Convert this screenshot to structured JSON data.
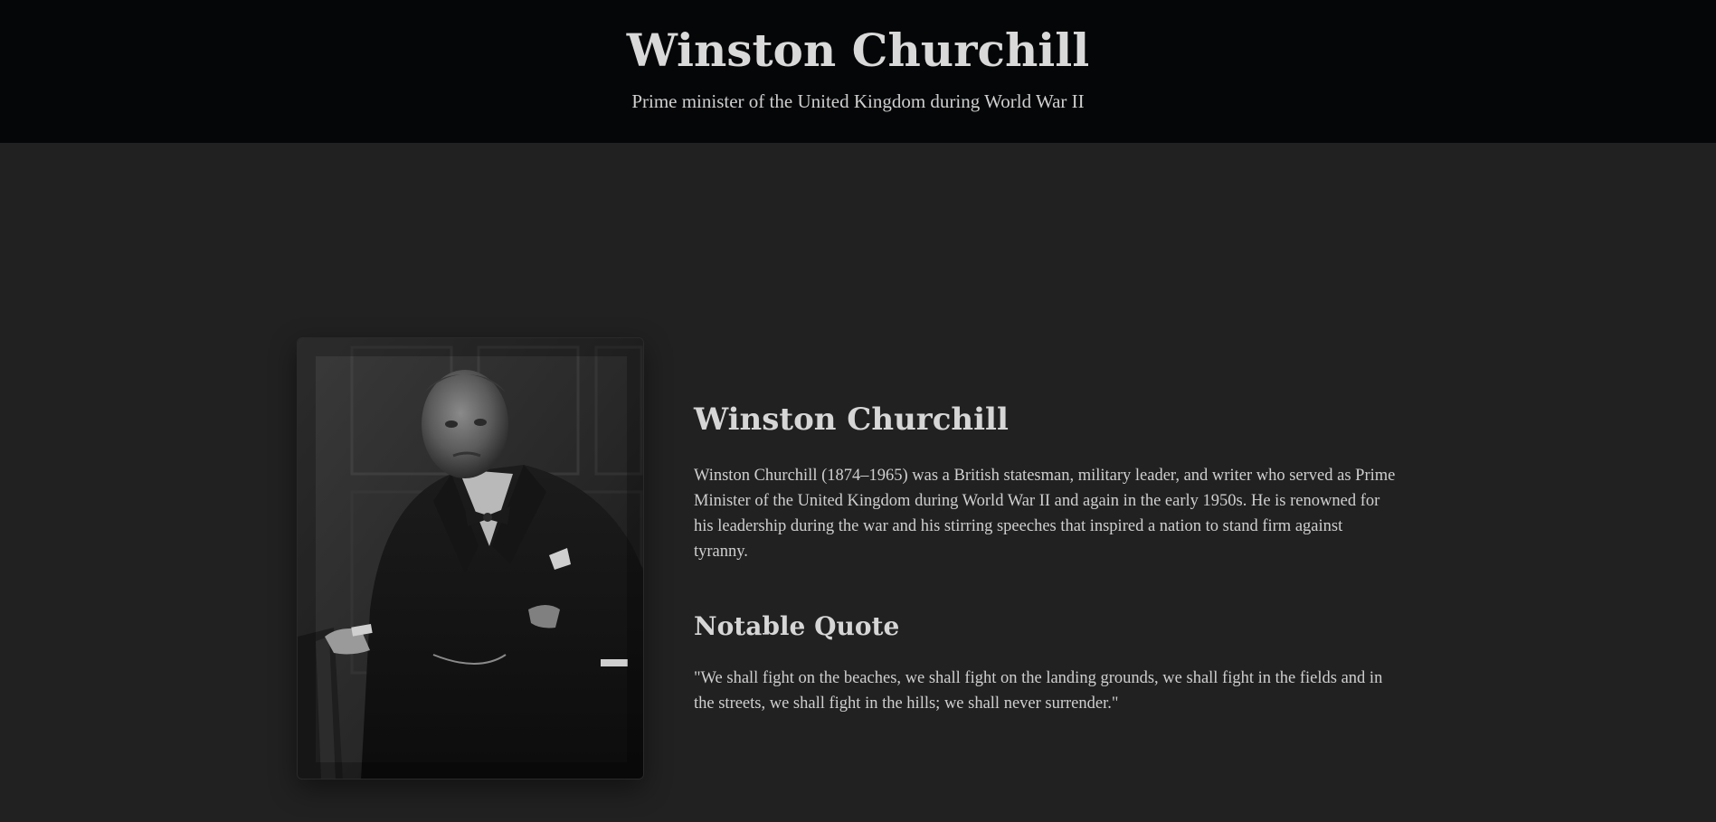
{
  "header": {
    "title": "Winston Churchill",
    "subtitle": "Prime minister of the United Kingdom during World War II"
  },
  "portrait": {
    "alt": "Winston Churchill"
  },
  "bio": {
    "heading": "Winston Churchill",
    "text": "Winston Churchill (1874–1965) was a British statesman, military leader, and writer who served as Prime Minister of the United Kingdom during World War II and again in the early 1950s. He is renowned for his leadership during the war and his stirring speeches that inspired a nation to stand firm against tyranny."
  },
  "quote": {
    "heading": "Notable Quote",
    "text": "\"We shall fight on the beaches, we shall fight on the landing grounds, we shall fight in the fields and in the streets, we shall fight in the hills; we shall never surrender.\""
  },
  "colors": {
    "header_bg": "#050608",
    "page_bg": "#212121",
    "text": "#cfcfcf"
  }
}
